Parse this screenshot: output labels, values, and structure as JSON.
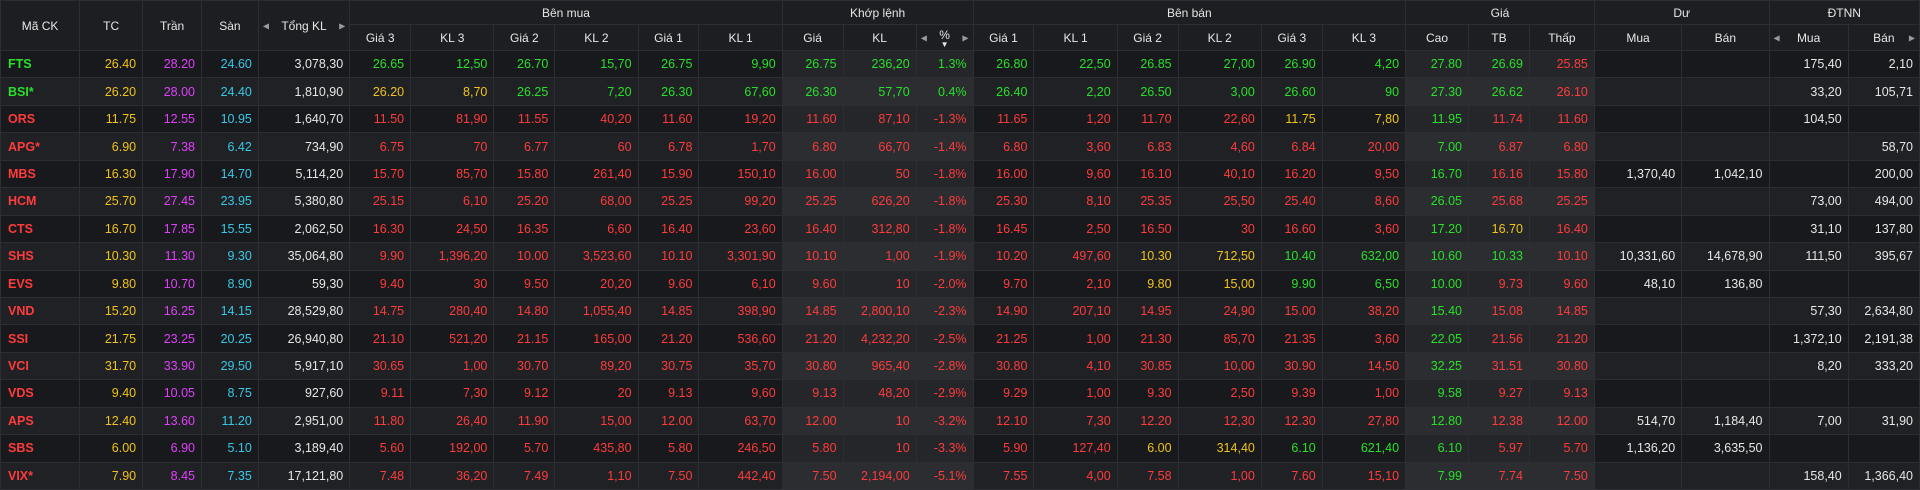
{
  "colors": {
    "up": "#28e028",
    "down": "#ff3b3b",
    "ref": "#f0c419",
    "ceil": "#e040fb",
    "floor": "#37c8e6",
    "white": "#e6e6e6"
  },
  "header": {
    "symbol": "Mã CK",
    "ref": "TC",
    "ceil": "Trần",
    "floor": "Sàn",
    "total_vol": "Tổng KL",
    "buy": "Bên mua",
    "match": "Khớp lệnh",
    "sell": "Bên bán",
    "price": "Giá",
    "residual": "Dư",
    "foreign": "ĐTNN",
    "buy_cols": [
      "Giá 3",
      "KL 3",
      "Giá 2",
      "KL 2",
      "Giá 1",
      "KL 1"
    ],
    "match_cols": [
      "Giá",
      "KL",
      "%"
    ],
    "sell_cols": [
      "Giá 1",
      "KL 1",
      "Giá 2",
      "KL 2",
      "Giá 3",
      "KL 3"
    ],
    "price_cols": [
      "Cao",
      "TB",
      "Thấp"
    ],
    "residual_cols": [
      "Mua",
      "Bán"
    ],
    "foreign_cols": [
      "Mua",
      "Bán"
    ]
  },
  "rows": [
    {
      "sym": "FTS",
      "tc": "26.40",
      "tran": "28.20",
      "san": "24.60",
      "tkl": "3,078,30",
      "b3p": "26.65",
      "b3v": "12,50",
      "b2p": "26.70",
      "b2v": "15,70",
      "b1p": "26.75",
      "b1v": "9,90",
      "mp": "26.75",
      "mv": "236,20",
      "pct": "1.3%",
      "s1p": "26.80",
      "s1v": "22,50",
      "s2p": "26.85",
      "s2v": "27,00",
      "s3p": "26.90",
      "s3v": "4,20",
      "hi": "27.80",
      "avg": "26.69",
      "lo": "25.85",
      "rb": "",
      "rs": "",
      "fb": "175,40",
      "fs": "2,10",
      "cl": {
        "sym": "up",
        "b3": "up",
        "b2": "up",
        "b1": "up",
        "m": "up",
        "s1": "up",
        "s2": "up",
        "s3": "up",
        "hi": "up",
        "avg": "up",
        "lo": "down"
      }
    },
    {
      "sym": "BSI*",
      "tc": "26.20",
      "tran": "28.00",
      "san": "24.40",
      "tkl": "1,810,90",
      "b3p": "26.20",
      "b3v": "8,70",
      "b2p": "26.25",
      "b2v": "7,20",
      "b1p": "26.30",
      "b1v": "67,60",
      "mp": "26.30",
      "mv": "57,70",
      "pct": "0.4%",
      "s1p": "26.40",
      "s1v": "2,20",
      "s2p": "26.50",
      "s2v": "3,00",
      "s3p": "26.60",
      "s3v": "90",
      "hi": "27.30",
      "avg": "26.62",
      "lo": "26.10",
      "rb": "",
      "rs": "",
      "fb": "33,20",
      "fs": "105,71",
      "cl": {
        "sym": "up",
        "b3": "ref",
        "b2": "up",
        "b1": "up",
        "m": "up",
        "s1": "up",
        "s2": "up",
        "s3": "up",
        "hi": "up",
        "avg": "up",
        "lo": "down"
      }
    },
    {
      "sym": "ORS",
      "tc": "11.75",
      "tran": "12.55",
      "san": "10.95",
      "tkl": "1,640,70",
      "b3p": "11.50",
      "b3v": "81,90",
      "b2p": "11.55",
      "b2v": "40,20",
      "b1p": "11.60",
      "b1v": "19,20",
      "mp": "11.60",
      "mv": "87,10",
      "pct": "-1.3%",
      "s1p": "11.65",
      "s1v": "1,20",
      "s2p": "11.70",
      "s2v": "22,60",
      "s3p": "11.75",
      "s3v": "7,80",
      "hi": "11.95",
      "avg": "11.74",
      "lo": "11.60",
      "rb": "",
      "rs": "",
      "fb": "104,50",
      "fs": "",
      "cl": {
        "sym": "down",
        "b3": "down",
        "b2": "down",
        "b1": "down",
        "m": "down",
        "s1": "down",
        "s2": "down",
        "s3": "ref",
        "hi": "up",
        "avg": "down",
        "lo": "down"
      }
    },
    {
      "sym": "APG*",
      "tc": "6.90",
      "tran": "7.38",
      "san": "6.42",
      "tkl": "734,90",
      "b3p": "6.75",
      "b3v": "70",
      "b2p": "6.77",
      "b2v": "60",
      "b1p": "6.78",
      "b1v": "1,70",
      "mp": "6.80",
      "mv": "66,70",
      "pct": "-1.4%",
      "s1p": "6.80",
      "s1v": "3,60",
      "s2p": "6.83",
      "s2v": "4,60",
      "s3p": "6.84",
      "s3v": "20,00",
      "hi": "7.00",
      "avg": "6.87",
      "lo": "6.80",
      "rb": "",
      "rs": "",
      "fb": "",
      "fs": "58,70",
      "cl": {
        "sym": "down",
        "b3": "down",
        "b2": "down",
        "b1": "down",
        "m": "down",
        "s1": "down",
        "s2": "down",
        "s3": "down",
        "hi": "up",
        "avg": "down",
        "lo": "down"
      }
    },
    {
      "sym": "MBS",
      "tc": "16.30",
      "tran": "17.90",
      "san": "14.70",
      "tkl": "5,114,20",
      "b3p": "15.70",
      "b3v": "85,70",
      "b2p": "15.80",
      "b2v": "261,40",
      "b1p": "15.90",
      "b1v": "150,10",
      "mp": "16.00",
      "mv": "50",
      "pct": "-1.8%",
      "s1p": "16.00",
      "s1v": "9,60",
      "s2p": "16.10",
      "s2v": "40,10",
      "s3p": "16.20",
      "s3v": "9,50",
      "hi": "16.70",
      "avg": "16.16",
      "lo": "15.80",
      "rb": "1,370,40",
      "rs": "1,042,10",
      "fb": "",
      "fs": "200,00",
      "cl": {
        "sym": "down",
        "b3": "down",
        "b2": "down",
        "b1": "down",
        "m": "down",
        "s1": "down",
        "s2": "down",
        "s3": "down",
        "hi": "up",
        "avg": "down",
        "lo": "down"
      }
    },
    {
      "sym": "HCM",
      "tc": "25.70",
      "tran": "27.45",
      "san": "23.95",
      "tkl": "5,380,80",
      "b3p": "25.15",
      "b3v": "6,10",
      "b2p": "25.20",
      "b2v": "68,00",
      "b1p": "25.25",
      "b1v": "99,20",
      "mp": "25.25",
      "mv": "626,20",
      "pct": "-1.8%",
      "s1p": "25.30",
      "s1v": "8,10",
      "s2p": "25.35",
      "s2v": "25,50",
      "s3p": "25.40",
      "s3v": "8,60",
      "hi": "26.05",
      "avg": "25.68",
      "lo": "25.25",
      "rb": "",
      "rs": "",
      "fb": "73,00",
      "fs": "494,00",
      "cl": {
        "sym": "down",
        "b3": "down",
        "b2": "down",
        "b1": "down",
        "m": "down",
        "s1": "down",
        "s2": "down",
        "s3": "down",
        "hi": "up",
        "avg": "down",
        "lo": "down"
      }
    },
    {
      "sym": "CTS",
      "tc": "16.70",
      "tran": "17.85",
      "san": "15.55",
      "tkl": "2,062,50",
      "b3p": "16.30",
      "b3v": "24,50",
      "b2p": "16.35",
      "b2v": "6,60",
      "b1p": "16.40",
      "b1v": "23,60",
      "mp": "16.40",
      "mv": "312,80",
      "pct": "-1.8%",
      "s1p": "16.45",
      "s1v": "2,50",
      "s2p": "16.50",
      "s2v": "30",
      "s3p": "16.60",
      "s3v": "3,60",
      "hi": "17.20",
      "avg": "16.70",
      "lo": "16.40",
      "rb": "",
      "rs": "",
      "fb": "31,10",
      "fs": "137,80",
      "cl": {
        "sym": "down",
        "b3": "down",
        "b2": "down",
        "b1": "down",
        "m": "down",
        "s1": "down",
        "s2": "down",
        "s3": "down",
        "hi": "up",
        "avg": "ref",
        "lo": "down"
      }
    },
    {
      "sym": "SHS",
      "tc": "10.30",
      "tran": "11.30",
      "san": "9.30",
      "tkl": "35,064,80",
      "b3p": "9.90",
      "b3v": "1,396,20",
      "b2p": "10.00",
      "b2v": "3,523,60",
      "b1p": "10.10",
      "b1v": "3,301,90",
      "mp": "10.10",
      "mv": "1,00",
      "pct": "-1.9%",
      "s1p": "10.20",
      "s1v": "497,60",
      "s2p": "10.30",
      "s2v": "712,50",
      "s3p": "10.40",
      "s3v": "632,00",
      "hi": "10.60",
      "avg": "10.33",
      "lo": "10.10",
      "rb": "10,331,60",
      "rs": "14,678,90",
      "fb": "111,50",
      "fs": "395,67",
      "cl": {
        "sym": "down",
        "b3": "down",
        "b2": "down",
        "b1": "down",
        "m": "down",
        "s1": "down",
        "s2": "ref",
        "s3": "up",
        "hi": "up",
        "avg": "up",
        "lo": "down"
      }
    },
    {
      "sym": "EVS",
      "tc": "9.80",
      "tran": "10.70",
      "san": "8.90",
      "tkl": "59,30",
      "b3p": "9.40",
      "b3v": "30",
      "b2p": "9.50",
      "b2v": "20,20",
      "b1p": "9.60",
      "b1v": "6,10",
      "mp": "9.60",
      "mv": "10",
      "pct": "-2.0%",
      "s1p": "9.70",
      "s1v": "2,10",
      "s2p": "9.80",
      "s2v": "15,00",
      "s3p": "9.90",
      "s3v": "6,50",
      "hi": "10.00",
      "avg": "9.73",
      "lo": "9.60",
      "rb": "48,10",
      "rs": "136,80",
      "fb": "",
      "fs": "",
      "cl": {
        "sym": "down",
        "b3": "down",
        "b2": "down",
        "b1": "down",
        "m": "down",
        "s1": "down",
        "s2": "ref",
        "s3": "up",
        "hi": "up",
        "avg": "down",
        "lo": "down"
      }
    },
    {
      "sym": "VND",
      "tc": "15.20",
      "tran": "16.25",
      "san": "14.15",
      "tkl": "28,529,80",
      "b3p": "14.75",
      "b3v": "280,40",
      "b2p": "14.80",
      "b2v": "1,055,40",
      "b1p": "14.85",
      "b1v": "398,90",
      "mp": "14.85",
      "mv": "2,800,10",
      "pct": "-2.3%",
      "s1p": "14.90",
      "s1v": "207,10",
      "s2p": "14.95",
      "s2v": "24,90",
      "s3p": "15.00",
      "s3v": "38,20",
      "hi": "15.40",
      "avg": "15.08",
      "lo": "14.85",
      "rb": "",
      "rs": "",
      "fb": "57,30",
      "fs": "2,634,80",
      "cl": {
        "sym": "down",
        "b3": "down",
        "b2": "down",
        "b1": "down",
        "m": "down",
        "s1": "down",
        "s2": "down",
        "s3": "down",
        "hi": "up",
        "avg": "down",
        "lo": "down"
      }
    },
    {
      "sym": "SSI",
      "tc": "21.75",
      "tran": "23.25",
      "san": "20.25",
      "tkl": "26,940,80",
      "b3p": "21.10",
      "b3v": "521,20",
      "b2p": "21.15",
      "b2v": "165,00",
      "b1p": "21.20",
      "b1v": "536,60",
      "mp": "21.20",
      "mv": "4,232,20",
      "pct": "-2.5%",
      "s1p": "21.25",
      "s1v": "1,00",
      "s2p": "21.30",
      "s2v": "85,70",
      "s3p": "21.35",
      "s3v": "3,60",
      "hi": "22.05",
      "avg": "21.56",
      "lo": "21.20",
      "rb": "",
      "rs": "",
      "fb": "1,372,10",
      "fs": "2,191,38",
      "cl": {
        "sym": "down",
        "b3": "down",
        "b2": "down",
        "b1": "down",
        "m": "down",
        "s1": "down",
        "s2": "down",
        "s3": "down",
        "hi": "up",
        "avg": "down",
        "lo": "down"
      }
    },
    {
      "sym": "VCI",
      "tc": "31.70",
      "tran": "33.90",
      "san": "29.50",
      "tkl": "5,917,10",
      "b3p": "30.65",
      "b3v": "1,00",
      "b2p": "30.70",
      "b2v": "89,20",
      "b1p": "30.75",
      "b1v": "35,70",
      "mp": "30.80",
      "mv": "965,40",
      "pct": "-2.8%",
      "s1p": "30.80",
      "s1v": "4,10",
      "s2p": "30.85",
      "s2v": "10,00",
      "s3p": "30.90",
      "s3v": "14,50",
      "hi": "32.25",
      "avg": "31.51",
      "lo": "30.80",
      "rb": "",
      "rs": "",
      "fb": "8,20",
      "fs": "333,20",
      "cl": {
        "sym": "down",
        "b3": "down",
        "b2": "down",
        "b1": "down",
        "m": "down",
        "s1": "down",
        "s2": "down",
        "s3": "down",
        "hi": "up",
        "avg": "down",
        "lo": "down"
      }
    },
    {
      "sym": "VDS",
      "tc": "9.40",
      "tran": "10.05",
      "san": "8.75",
      "tkl": "927,60",
      "b3p": "9.11",
      "b3v": "7,30",
      "b2p": "9.12",
      "b2v": "20",
      "b1p": "9.13",
      "b1v": "9,60",
      "mp": "9.13",
      "mv": "48,20",
      "pct": "-2.9%",
      "s1p": "9.29",
      "s1v": "1,00",
      "s2p": "9.30",
      "s2v": "2,50",
      "s3p": "9.39",
      "s3v": "1,00",
      "hi": "9.58",
      "avg": "9.27",
      "lo": "9.13",
      "rb": "",
      "rs": "",
      "fb": "",
      "fs": "",
      "cl": {
        "sym": "down",
        "b3": "down",
        "b2": "down",
        "b1": "down",
        "m": "down",
        "s1": "down",
        "s2": "down",
        "s3": "down",
        "hi": "up",
        "avg": "down",
        "lo": "down"
      }
    },
    {
      "sym": "APS",
      "tc": "12.40",
      "tran": "13.60",
      "san": "11.20",
      "tkl": "2,951,00",
      "b3p": "11.80",
      "b3v": "26,40",
      "b2p": "11.90",
      "b2v": "15,00",
      "b1p": "12.00",
      "b1v": "63,70",
      "mp": "12.00",
      "mv": "10",
      "pct": "-3.2%",
      "s1p": "12.10",
      "s1v": "7,30",
      "s2p": "12.20",
      "s2v": "12,30",
      "s3p": "12.30",
      "s3v": "27,80",
      "hi": "12.80",
      "avg": "12.38",
      "lo": "12.00",
      "rb": "514,70",
      "rs": "1,184,40",
      "fb": "7,00",
      "fs": "31,90",
      "cl": {
        "sym": "down",
        "b3": "down",
        "b2": "down",
        "b1": "down",
        "m": "down",
        "s1": "down",
        "s2": "down",
        "s3": "down",
        "hi": "up",
        "avg": "down",
        "lo": "down"
      }
    },
    {
      "sym": "SBS",
      "tc": "6.00",
      "tran": "6.90",
      "san": "5.10",
      "tkl": "3,189,40",
      "b3p": "5.60",
      "b3v": "192,00",
      "b2p": "5.70",
      "b2v": "435,80",
      "b1p": "5.80",
      "b1v": "246,50",
      "mp": "5.80",
      "mv": "10",
      "pct": "-3.3%",
      "s1p": "5.90",
      "s1v": "127,40",
      "s2p": "6.00",
      "s2v": "314,40",
      "s3p": "6.10",
      "s3v": "621,40",
      "hi": "6.10",
      "avg": "5.97",
      "lo": "5.70",
      "rb": "1,136,20",
      "rs": "3,635,50",
      "fb": "",
      "fs": "",
      "cl": {
        "sym": "down",
        "b3": "down",
        "b2": "down",
        "b1": "down",
        "m": "down",
        "s1": "down",
        "s2": "ref",
        "s3": "up",
        "hi": "up",
        "avg": "down",
        "lo": "down"
      }
    },
    {
      "sym": "VIX*",
      "tc": "7.90",
      "tran": "8.45",
      "san": "7.35",
      "tkl": "17,121,80",
      "b3p": "7.48",
      "b3v": "36,20",
      "b2p": "7.49",
      "b2v": "1,10",
      "b1p": "7.50",
      "b1v": "442,40",
      "mp": "7.50",
      "mv": "2,194,00",
      "pct": "-5.1%",
      "s1p": "7.55",
      "s1v": "4,00",
      "s2p": "7.58",
      "s2v": "1,00",
      "s3p": "7.60",
      "s3v": "15,10",
      "hi": "7.99",
      "avg": "7.74",
      "lo": "7.50",
      "rb": "",
      "rs": "",
      "fb": "158,40",
      "fs": "1,366,40",
      "cl": {
        "sym": "down",
        "b3": "down",
        "b2": "down",
        "b1": "down",
        "m": "down",
        "s1": "down",
        "s2": "down",
        "s3": "down",
        "hi": "up",
        "avg": "down",
        "lo": "down"
      }
    }
  ]
}
